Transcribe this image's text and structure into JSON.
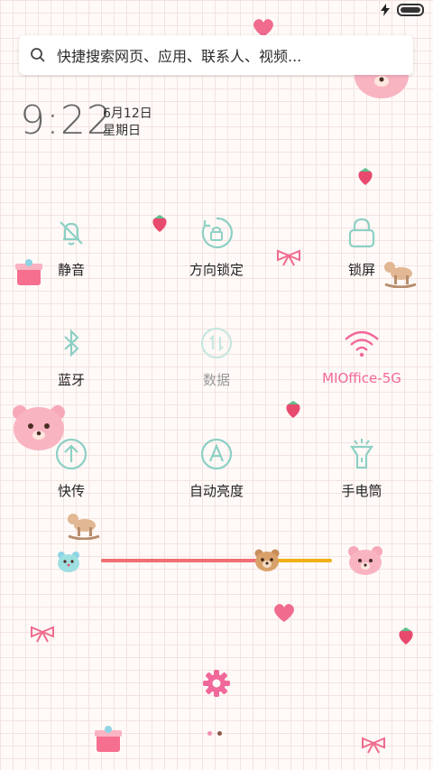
{
  "status_bar": {
    "charging_icon": "lightning-icon",
    "battery_icon": "battery-icon"
  },
  "search": {
    "placeholder": "快捷搜索网页、应用、联系人、视频..."
  },
  "clock": {
    "time": "9:22",
    "date": "6月12日",
    "weekday": "星期日"
  },
  "toggles": [
    {
      "label": "静音",
      "icon": "bell-off-icon",
      "state": "off"
    },
    {
      "label": "方向锁定",
      "icon": "rotation-lock-icon",
      "state": "off"
    },
    {
      "label": "锁屏",
      "icon": "lock-icon",
      "state": "off"
    },
    {
      "label": "蓝牙",
      "icon": "bluetooth-icon",
      "state": "off"
    },
    {
      "label": "数据",
      "icon": "mobile-data-icon",
      "state": "disabled"
    },
    {
      "label": "MIOffice-5G",
      "icon": "wifi-icon",
      "state": "on"
    },
    {
      "label": "快传",
      "icon": "transfer-icon",
      "state": "off"
    },
    {
      "label": "自动亮度",
      "icon": "auto-brightness-icon",
      "state": "off"
    },
    {
      "label": "手电筒",
      "icon": "flashlight-icon",
      "state": "off"
    }
  ],
  "brightness": {
    "level": 0.72
  },
  "colors": {
    "accent": "#8dd0c4",
    "wifi_on": "#f1689a",
    "slider_low": "#ef6f75",
    "slider_high": "#f2b016",
    "gear": "#f1689a"
  },
  "pager": {
    "pages": 2,
    "active": 2
  }
}
